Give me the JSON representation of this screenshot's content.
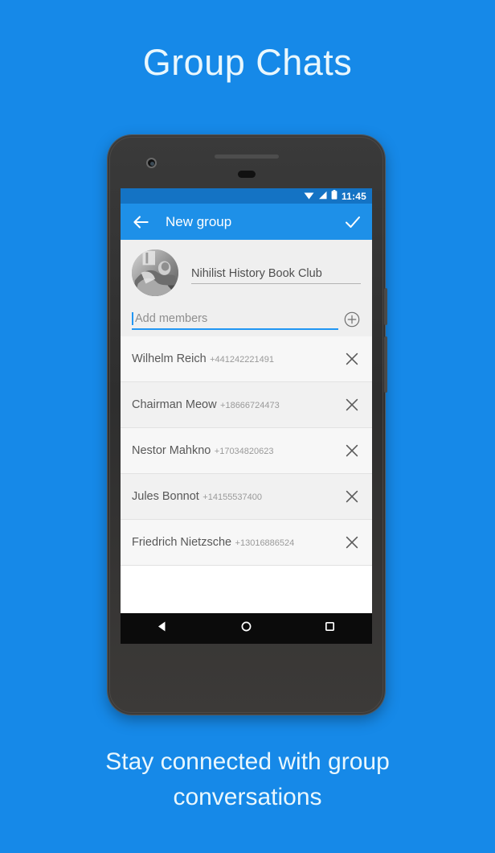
{
  "promo": {
    "headline": "Group Chats",
    "caption_line1": "Stay connected with group",
    "caption_line2": "conversations",
    "background_color": "#1689E8",
    "text_color": "#E9F7FD"
  },
  "device": {
    "frame_color": "#333333",
    "hardware": {
      "camera": "front-camera",
      "speaker": "earpiece-speaker",
      "sensor": "proximity-sensor"
    }
  },
  "screen": {
    "statusbar": {
      "time": "11:45",
      "icons": [
        "wifi-icon",
        "signal-icon",
        "battery-icon"
      ],
      "background_color": "#1473C4"
    },
    "appbar": {
      "back_icon": "arrow-back-icon",
      "title": "New group",
      "done_icon": "check-icon",
      "background_color": "#1E90E8"
    },
    "group_header": {
      "avatar_icon": "group-photo-avatar",
      "group_name_value": "Nihilist History Book Club",
      "add_members_placeholder": "Add members",
      "add_member_icon": "add-circle-icon",
      "focus_color": "#2196F3"
    },
    "members": [
      {
        "name": "Wilhelm Reich",
        "phone": "+441242221491",
        "remove_icon": "close-icon"
      },
      {
        "name": "Chairman Meow",
        "phone": "+18666724473",
        "remove_icon": "close-icon"
      },
      {
        "name": "Nestor Mahkno",
        "phone": "+17034820623",
        "remove_icon": "close-icon"
      },
      {
        "name": "Jules Bonnot",
        "phone": "+14155537400",
        "remove_icon": "close-icon"
      },
      {
        "name": "Friedrich Nietzsche",
        "phone": "+13016886524",
        "remove_icon": "close-icon"
      }
    ],
    "navbar": {
      "back_icon": "nav-back-triangle-icon",
      "home_icon": "nav-home-circle-icon",
      "recents_icon": "nav-recents-square-icon",
      "background_color": "#0b0b0b"
    }
  }
}
